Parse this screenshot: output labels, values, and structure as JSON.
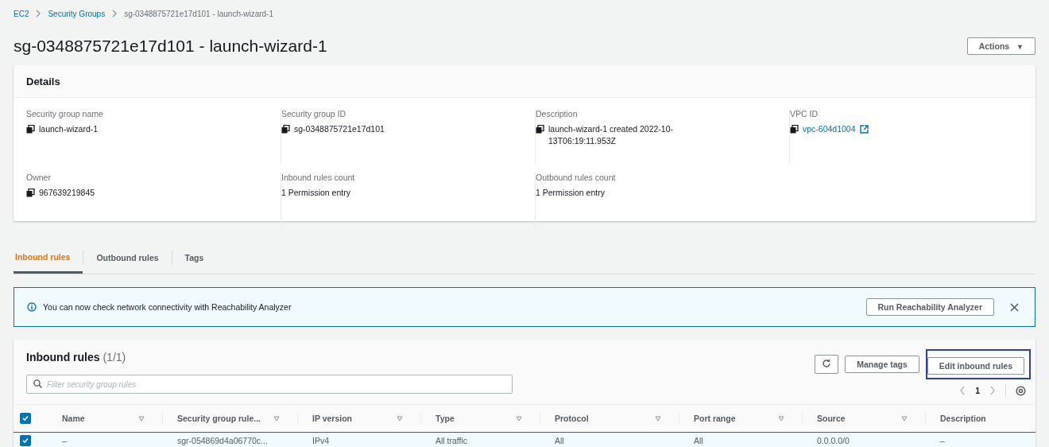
{
  "breadcrumb": [
    {
      "label": "EC2",
      "link": true
    },
    {
      "label": "Security Groups",
      "link": true
    },
    {
      "label": "sg-0348875721e17d101 - launch-wizard-1",
      "link": false
    }
  ],
  "title": "sg-0348875721e17d101 - launch-wizard-1",
  "actions": {
    "label": "Actions",
    "caret": "▼"
  },
  "details": {
    "title": "Details",
    "rows": [
      [
        {
          "label": "Security group name",
          "value": "launch-wizard-1",
          "copyable": true,
          "link": false
        },
        {
          "label": "Security group ID",
          "value": "sg-0348875721e17d101",
          "copyable": true,
          "link": false
        },
        {
          "label": "Description",
          "value": "launch-wizard-1 created 2022-10-13T06:19:11.953Z",
          "copyable": true,
          "link": false
        },
        {
          "label": "VPC ID",
          "value": "vpc-604d1004",
          "copyable": true,
          "link": true
        }
      ],
      [
        {
          "label": "Owner",
          "value": "967639219845",
          "copyable": true,
          "link": false
        },
        {
          "label": "Inbound rules count",
          "value": "1 Permission entry",
          "copyable": false,
          "link": false
        },
        {
          "label": "Outbound rules count",
          "value": "1 Permission entry",
          "copyable": false,
          "link": false
        }
      ]
    ]
  },
  "tabs": [
    {
      "label": "Inbound rules",
      "selected": true
    },
    {
      "label": "Outbound rules",
      "selected": false
    },
    {
      "label": "Tags",
      "selected": false
    }
  ],
  "alert": {
    "text": "You can now check network connectivity with Reachability Analyzer",
    "button": "Run Reachability Analyzer"
  },
  "table": {
    "title": "Inbound rules",
    "count": "(1/1)",
    "buttons": [
      {
        "label": "Manage tags",
        "highlighted": false
      },
      {
        "label": "Edit inbound rules",
        "highlighted": true
      }
    ],
    "search": {
      "placeholder": "Filter security group rules"
    },
    "page": "1",
    "select_all": true,
    "columns": [
      "Name",
      "Security group rule...",
      "IP version",
      "Type",
      "Protocol",
      "Port range",
      "Source",
      "Description"
    ],
    "rows": [
      {
        "checked": true,
        "cells": [
          "–",
          "sgr-054869d4a06770c...",
          "IPv4",
          "All traffic",
          "All",
          "All",
          "0.0.0.0/0",
          "–"
        ]
      }
    ]
  }
}
